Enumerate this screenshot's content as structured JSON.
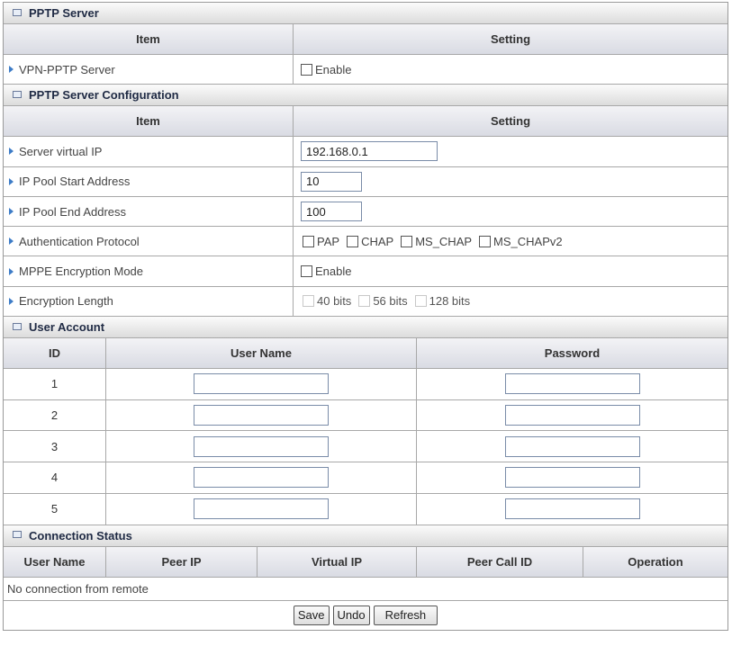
{
  "pptp_server": {
    "title": "PPTP Server",
    "col_item": "Item",
    "col_setting": "Setting",
    "vpn_label": "VPN-PPTP Server",
    "vpn_enable_label": "Enable"
  },
  "config": {
    "title": "PPTP Server Configuration",
    "col_item": "Item",
    "col_setting": "Setting",
    "server_ip_label": "Server virtual IP",
    "server_ip_value": "192.168.0.1",
    "pool_start_label": "IP Pool Start Address",
    "pool_start_value": "10",
    "pool_end_label": "IP Pool End Address",
    "pool_end_value": "100",
    "auth_label": "Authentication Protocol",
    "auth_options": [
      "PAP",
      "CHAP",
      "MS_CHAP",
      "MS_CHAPv2"
    ],
    "mppe_label": "MPPE Encryption Mode",
    "mppe_enable_label": "Enable",
    "enc_length_label": "Encryption Length",
    "enc_length_options": [
      "40 bits",
      "56 bits",
      "128 bits"
    ]
  },
  "user_account": {
    "title": "User Account",
    "col_id": "ID",
    "col_user": "User Name",
    "col_pass": "Password",
    "rows": [
      {
        "id": "1",
        "user": "",
        "pass": ""
      },
      {
        "id": "2",
        "user": "",
        "pass": ""
      },
      {
        "id": "3",
        "user": "",
        "pass": ""
      },
      {
        "id": "4",
        "user": "",
        "pass": ""
      },
      {
        "id": "5",
        "user": "",
        "pass": ""
      }
    ]
  },
  "connection_status": {
    "title": "Connection Status",
    "columns": [
      "User Name",
      "Peer IP",
      "Virtual IP",
      "Peer Call ID",
      "Operation"
    ],
    "message": "No connection from remote"
  },
  "buttons": {
    "save": "Save",
    "undo": "Undo",
    "refresh": "Refresh"
  }
}
